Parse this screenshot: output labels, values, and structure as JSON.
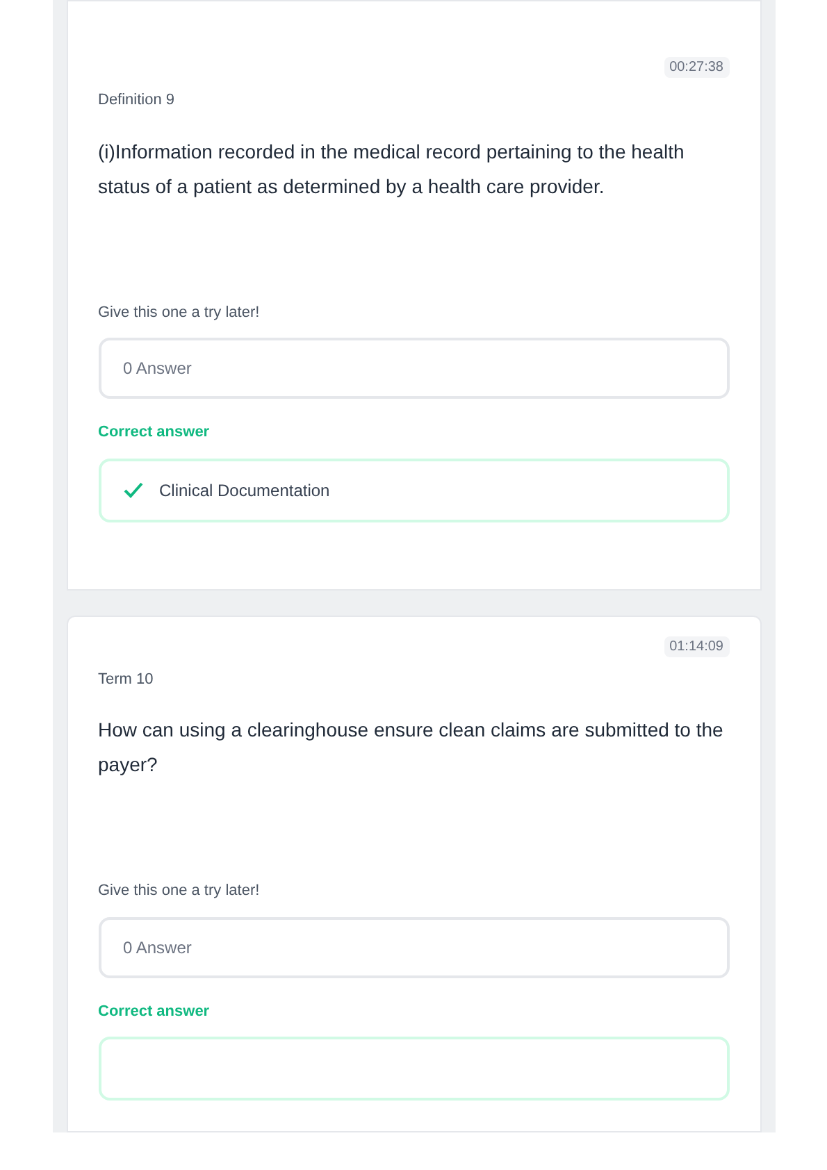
{
  "cards": [
    {
      "badge": "00:27:38",
      "label": "Definition 9",
      "prompt": "(i)Information recorded in the medical record pertaining to the health status of a patient as determined by a health care provider.",
      "hint": "Give this one a try later!",
      "response": "0 Answer",
      "correct_label": "Correct answer",
      "correct_answer": "Clinical Documentation"
    },
    {
      "badge": "01:14:09",
      "label": "Term 10",
      "prompt": "How can using a clearinghouse ensure clean claims are submitted to the payer?",
      "hint": "Give this one a try later!",
      "response": "0 Answer",
      "correct_label": "Correct answer"
    }
  ]
}
